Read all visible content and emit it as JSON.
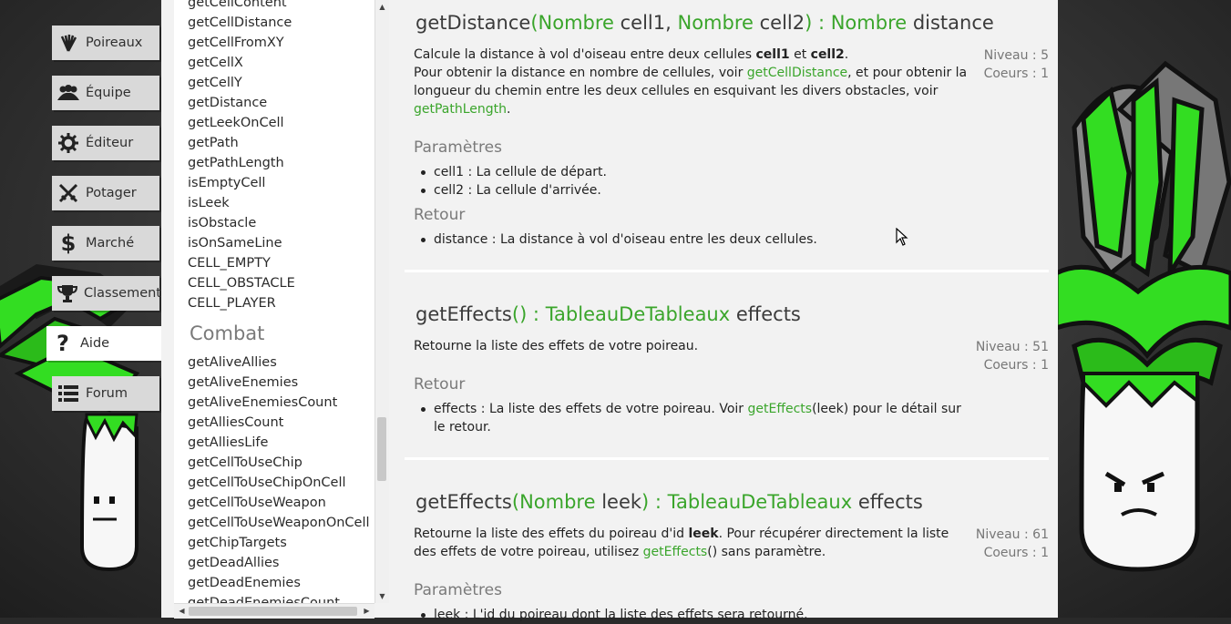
{
  "nav": {
    "items": [
      {
        "label": "Poireaux",
        "icon": "leek-icon"
      },
      {
        "label": "Équipe",
        "icon": "team-icon"
      },
      {
        "label": "Éditeur",
        "icon": "gear-icon"
      },
      {
        "label": "Potager",
        "icon": "swords-icon"
      },
      {
        "label": "Marché",
        "icon": "dollar-icon"
      },
      {
        "label": "Classement",
        "icon": "trophy-icon"
      },
      {
        "label": "Aide",
        "icon": "help-icon"
      },
      {
        "label": "Forum",
        "icon": "list-icon"
      }
    ]
  },
  "function_list": {
    "field_functions": [
      "getCellContent",
      "getCellDistance",
      "getCellFromXY",
      "getCellX",
      "getCellY",
      "getDistance",
      "getLeekOnCell",
      "getPath",
      "getPathLength",
      "isEmptyCell",
      "isLeek",
      "isObstacle",
      "isOnSameLine",
      "CELL_EMPTY",
      "CELL_OBSTACLE",
      "CELL_PLAYER"
    ],
    "combat_title": "Combat",
    "combat_functions": [
      "getAliveAllies",
      "getAliveEnemies",
      "getAliveEnemiesCount",
      "getAlliesCount",
      "getAlliesLife",
      "getCellToUseChip",
      "getCellToUseChipOnCell",
      "getCellToUseWeapon",
      "getCellToUseWeaponOnCell",
      "getChipTargets",
      "getDeadAllies",
      "getDeadEnemies",
      "getDeadEnemiesCount"
    ]
  },
  "docs": {
    "getDistance": {
      "name": "getDistance",
      "open": "(",
      "p1_type": "Nombre",
      "p1_name": " cell1, ",
      "p2_type": "Nombre",
      "p2_name": " cell2",
      "close": ") : ",
      "ret_type": "Nombre",
      "ret_name": " distance",
      "desc1": "Calcule la distance à vol d'oiseau entre deux cellules ",
      "desc1_b1": "cell1",
      "desc1_and": " et ",
      "desc1_b2": "cell2",
      ".": ".",
      "desc2": "Pour obtenir la distance en nombre de cellules, voir ",
      "link1": "getCellDistance",
      "desc3": ", et pour obtenir la longueur du chemin entre les deux cellules en esquivant les divers obstacles, voir ",
      "link2": "getPathLength",
      "level": "Niveau : 5",
      "cores": "Coeurs : 1",
      "params_title": "Paramètres",
      "param1": "cell1 : La cellule de départ.",
      "param2": "cell2 : La cellule d'arrivée.",
      "return_title": "Retour",
      "ret1": "distance : La distance à vol d'oiseau entre les deux cellules."
    },
    "getEffects1": {
      "name": "getEffects",
      "open": "() : ",
      "ret_type": "TableauDeTableaux",
      "ret_name": " effects",
      "desc": "Retourne la liste des effets de votre poireau.",
      "level": "Niveau : 51",
      "cores": "Coeurs : 1",
      "return_title": "Retour",
      "ret_a": "effects : La liste des effets de votre poireau. Voir ",
      "ret_link": "getEffects",
      "ret_b": "(leek) pour le détail sur le retour."
    },
    "getEffects2": {
      "name": "getEffects",
      "open": "(",
      "p1_type": "Nombre",
      "p1_name": " leek",
      "close": ") : ",
      "ret_type": "TableauDeTableaux",
      "ret_name": " effects",
      "desc_a": "Retourne la liste des effets du poireau d'id ",
      "desc_b": "leek",
      "desc_c": ". Pour récupérer directement la liste des effets de votre poireau, utilisez ",
      "desc_link": "getEffects",
      "desc_d": "() sans paramètre.",
      "level": "Niveau : 61",
      "cores": "Coeurs : 1",
      "params_title": "Paramètres",
      "param1": "leek : L'id du poireau dont la liste des effets sera retourné."
    }
  },
  "colors": {
    "accent": "#3aa52b",
    "leek_green": "#33dd22"
  }
}
